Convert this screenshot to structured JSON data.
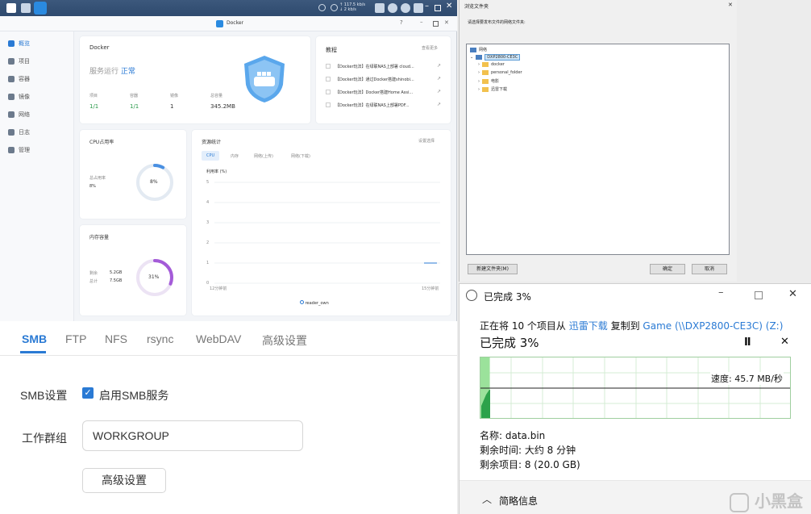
{
  "colors": {
    "accent": "#2a7ad4",
    "green": "#2a9a4a",
    "progress_green": "#33b34a",
    "donut_blue": "#4a90e2",
    "donut_purple": "#a45bd8"
  },
  "taskbar": {
    "speed_up": "↑ 117.5 kb/s",
    "speed_down": "↓ 2 kb/s",
    "icons": [
      "notification-icon",
      "user-icon",
      "search-icon",
      "grid-icon",
      "widget-icon"
    ]
  },
  "docker": {
    "window_title": "Docker",
    "sidebar": [
      {
        "label": "概览",
        "icon": "overview-icon"
      },
      {
        "label": "项目",
        "icon": "project-icon"
      },
      {
        "label": "容器",
        "icon": "container-icon"
      },
      {
        "label": "镜像",
        "icon": "image-icon"
      },
      {
        "label": "网络",
        "icon": "network-icon"
      },
      {
        "label": "日志",
        "icon": "log-icon"
      },
      {
        "label": "管理",
        "icon": "manage-icon"
      }
    ],
    "summary": {
      "title": "Docker",
      "status_prefix": "服务运行",
      "status": "正常",
      "stats": [
        {
          "label": "项目",
          "value": "1/1"
        },
        {
          "label": "容器",
          "value": "1/1"
        },
        {
          "label": "镜像",
          "value": "1"
        },
        {
          "label": "总容量",
          "value": "345.2MB"
        }
      ]
    },
    "tutorial": {
      "title": "教程",
      "more": "查看更多",
      "items": [
        "【Docker玩法】在绿联NAS上部署 cloud...",
        "【Docker玩法】通过Docker搭建shinobi...",
        "【Docker玩法】Docker搭建Home Assi...",
        "【Docker玩法】在绿联NAS上部署PDF..."
      ]
    },
    "cpu": {
      "title": "CPU占用率",
      "label": "总占用率",
      "value": "8%",
      "center": "8%",
      "fraction": 0.08
    },
    "memory": {
      "title": "内存容量",
      "used_label": "剩余",
      "used": "5.2GB",
      "total_label": "总计",
      "total": "7.5GB",
      "center": "31%",
      "fraction": 0.31
    },
    "resource": {
      "title": "资源统计",
      "action": "设置选择",
      "tabs": [
        "CPU",
        "内存",
        "网络(上传)",
        "网络(下载)"
      ],
      "unit_label": "利用率 (%)",
      "y_ticks": [
        "5",
        "4",
        "3",
        "2",
        "1",
        "0"
      ],
      "x_start": "12分钟前",
      "x_end": "15分钟前",
      "legend": "reader_own"
    }
  },
  "smb": {
    "tabs": [
      "SMB",
      "FTP",
      "NFS",
      "rsync",
      "WebDAV",
      "高级设置"
    ],
    "settings_label": "SMB设置",
    "enable_label": "启用SMB服务",
    "workgroup_label": "工作群组",
    "workgroup_value": "WORKGROUP",
    "advanced_button": "高级设置"
  },
  "browse": {
    "title": "浏览文件夹",
    "prompt": "请选择要发布文件的网络文件夹:",
    "tree": {
      "root": "网络",
      "device": "DXP2800-CE3C",
      "folders": [
        "docker",
        "personal_folder",
        "电影",
        "迅雷下载"
      ]
    },
    "new_folder": "新建文件夹(M)",
    "ok": "确定",
    "cancel": "取消"
  },
  "copy": {
    "title": "已完成 3%",
    "line_prefix": "正在将 10 个项目从",
    "source": "迅雷下载",
    "line_mid": "复制到",
    "dest": "Game (\\\\DXP2800-CE3C) (Z:)",
    "progress_text": "已完成 3%",
    "progress": 0.03,
    "speed": "速度: 45.7 MB/秒",
    "name_label": "名称: data.bin",
    "time_label": "剩余时间: 大约 8 分钟",
    "items_label": "剩余项目: 8 (20.0 GB)",
    "brief": "简略信息"
  },
  "watermark": "小黑盒"
}
